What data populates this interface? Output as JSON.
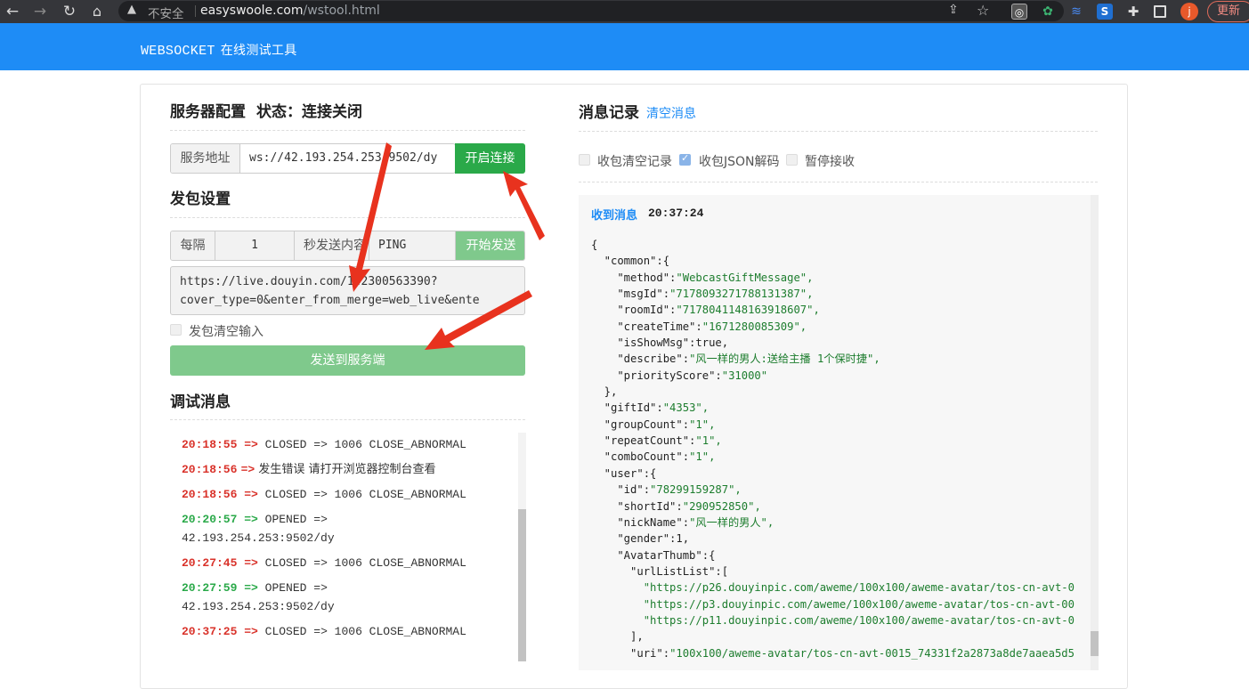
{
  "browser": {
    "security_label": "不安全",
    "url_host": "easyswoole.com",
    "url_path": "/wstool.html",
    "avatar_letter": "j",
    "update_label": "更新"
  },
  "banner": {
    "title": "WEBSOCKET",
    "subtitle": "在线测试工具"
  },
  "server": {
    "title": "服务器配置",
    "status": "状态：连接关闭",
    "addr_label": "服务地址",
    "addr_value": "ws://42.193.254.253:9502/dy",
    "connect_label": "开启连接"
  },
  "packet": {
    "title": "发包设置",
    "every_label": "每隔",
    "interval": "1",
    "seconds_label": "秒发送内容",
    "content": "PING",
    "start_label": "开始发送",
    "body_line1": "https://live.douyin.com/142300563390?",
    "body_line2": "cover_type=0&enter_from_merge=web_live&ente",
    "clear_after_send": "发包清空输入",
    "send_label": "发送到服务端"
  },
  "debug": {
    "title": "调试消息",
    "entries": [
      {
        "time": "20:18:55",
        "arrow": "=>",
        "text": "CLOSED => 1006 CLOSE_ABNORMAL",
        "text2": "",
        "color": "#d9322a"
      },
      {
        "time": "20:18:56",
        "arrow": "=>",
        "text": "发生错误  请打开浏览器控制台查看",
        "text2": "",
        "color": "#d9322a"
      },
      {
        "time": "20:18:56",
        "arrow": "=>",
        "text": "CLOSED => 1006 CLOSE_ABNORMAL",
        "text2": "",
        "color": "#d9322a"
      },
      {
        "time": "20:20:57",
        "arrow": "=>",
        "text": "OPENED =>",
        "text2": "42.193.254.253:9502/dy",
        "color": "#2aa949"
      },
      {
        "time": "20:27:45",
        "arrow": "=>",
        "text": "CLOSED => 1006 CLOSE_ABNORMAL",
        "text2": "",
        "color": "#d9322a"
      },
      {
        "time": "20:27:59",
        "arrow": "=>",
        "text": "OPENED =>",
        "text2": "42.193.254.253:9502/dy",
        "color": "#2aa949"
      },
      {
        "time": "20:37:25",
        "arrow": "=>",
        "text": "CLOSED => 1006 CLOSE_ABNORMAL",
        "text2": "",
        "color": "#d9322a"
      }
    ]
  },
  "messages": {
    "title": "消息记录",
    "clear_label": "清空消息",
    "opt_clear": "收包清空记录",
    "opt_json": "收包JSON解码",
    "opt_pause": "暂停接收",
    "received_label": "收到消息",
    "received_time": "20:37:24",
    "json_lines": [
      "{",
      "  \"common\":{",
      "    \"method\":\"WebcastGiftMessage\",",
      "    \"msgId\":\"7178093271788131387\",",
      "    \"roomId\":\"7178041148163918607\",",
      "    \"createTime\":\"1671280085309\",",
      "    \"isShowMsg\":true,",
      "    \"describe\":\"风一样的男人:送给主播 1个保时捷\",",
      "    \"priorityScore\":\"31000\"",
      "  },",
      "  \"giftId\":\"4353\",",
      "  \"groupCount\":\"1\",",
      "  \"repeatCount\":\"1\",",
      "  \"comboCount\":\"1\",",
      "  \"user\":{",
      "    \"id\":\"78299159287\",",
      "    \"shortId\":\"290952850\",",
      "    \"nickName\":\"风一样的男人\",",
      "    \"gender\":1,",
      "    \"AvatarThumb\":{",
      "      \"urlListList\":[",
      "        \"https://p26.douyinpic.com/aweme/100x100/aweme-avatar/tos-cn-avt-0",
      "        \"https://p3.douyinpic.com/aweme/100x100/aweme-avatar/tos-cn-avt-00",
      "        \"https://p11.douyinpic.com/aweme/100x100/aweme-avatar/tos-cn-avt-0",
      "      ],",
      "      \"uri\":\"100x100/aweme-avatar/tos-cn-avt-0015_74331f2a2873a8de7aaea5d5"
    ]
  },
  "colors": {
    "brand": "#1e8cf6",
    "green": "#2aa949",
    "red": "#d9322a",
    "arrow": "#e8321e"
  }
}
